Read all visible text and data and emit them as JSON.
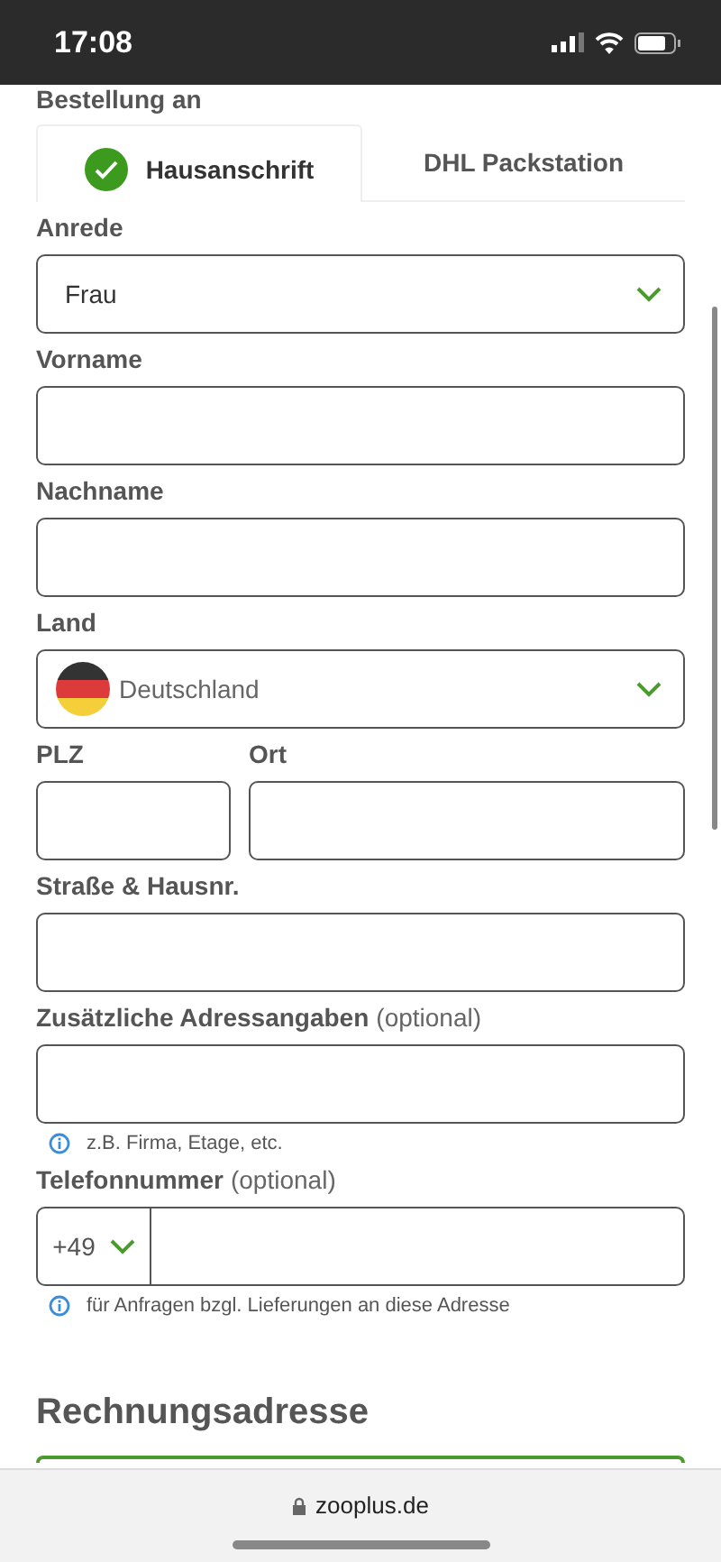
{
  "status_bar": {
    "time": "17:08"
  },
  "section_title": "Bestellung an",
  "tabs": [
    {
      "label": "Hausanschrift",
      "selected": true
    },
    {
      "label": "DHL Packstation",
      "selected": false
    }
  ],
  "fields": [
    {
      "kind": "select",
      "label": "Anrede",
      "value": "Frau"
    },
    {
      "kind": "text",
      "label": "Vorname"
    },
    {
      "kind": "text",
      "label": "Nachname"
    },
    {
      "kind": "country",
      "label": "Land",
      "value": "Deutschland"
    },
    {
      "kind": "pair",
      "items": [
        {
          "label": "PLZ"
        },
        {
          "label": "Ort"
        }
      ]
    },
    {
      "kind": "text",
      "label": "Straße & Hausnr."
    },
    {
      "kind": "text",
      "label": "Zusätzliche Adressangaben",
      "note": "(optional)",
      "hint": "z.B. Firma, Etage, etc."
    },
    {
      "kind": "phone",
      "label": "Telefonnummer",
      "note": "(optional)",
      "prefix": "+49",
      "hint": "für Anfragen bzgl. Lieferungen an diese Adresse"
    }
  ],
  "billing_title": "Rechnungsadresse",
  "browser_bar": {
    "url": "zooplus.de"
  }
}
